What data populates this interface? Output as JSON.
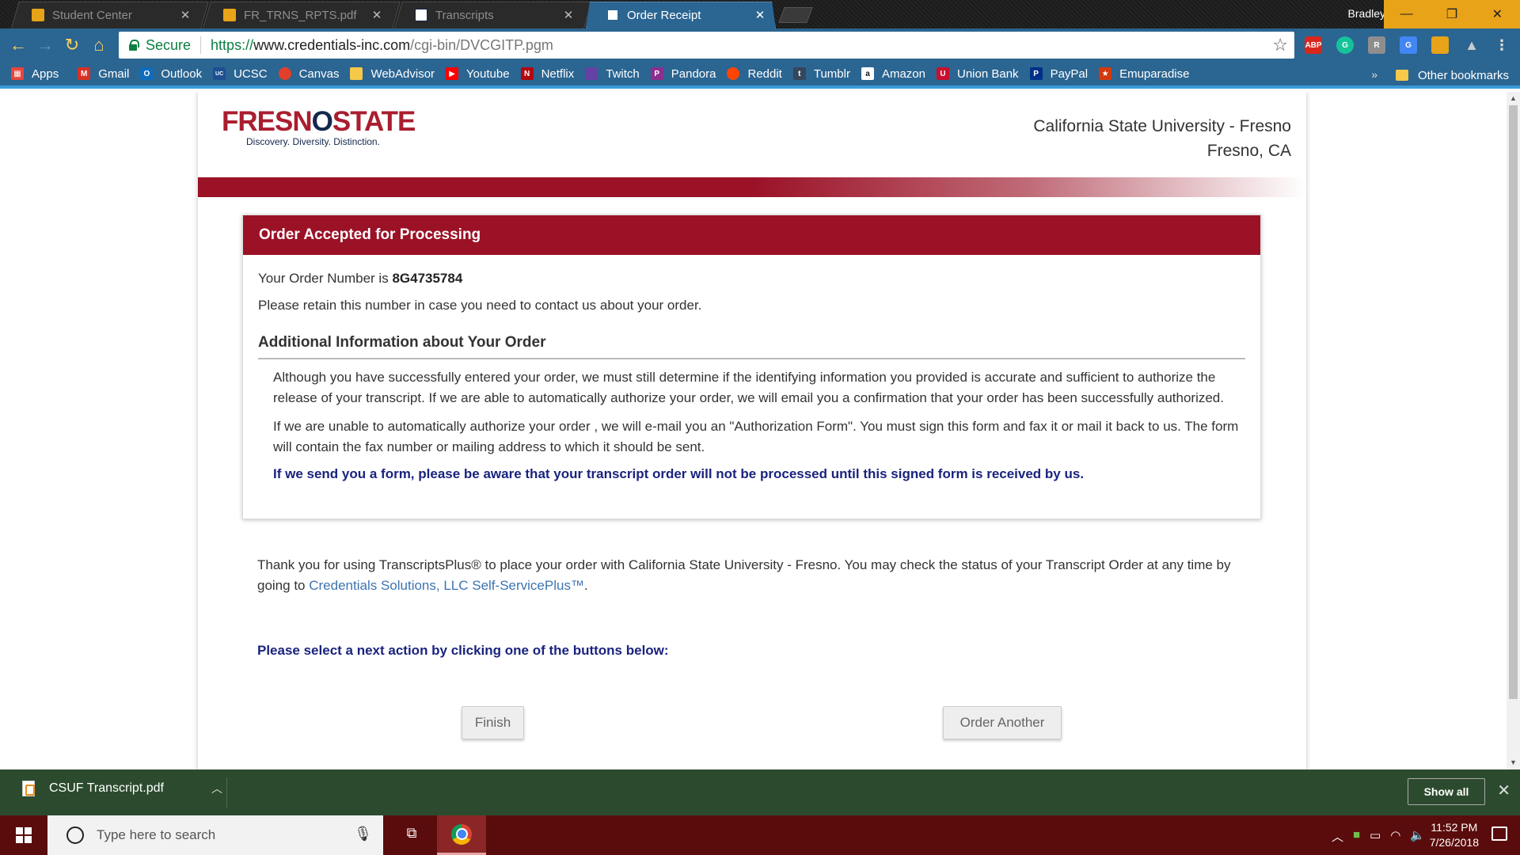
{
  "browser": {
    "tabs": [
      {
        "title": "Student Center",
        "active": false
      },
      {
        "title": "FR_TRNS_RPTS.pdf",
        "active": false
      },
      {
        "title": "Transcripts",
        "active": false
      },
      {
        "title": "Order Receipt",
        "active": true
      }
    ],
    "profile_name": "Bradley",
    "address": {
      "secure_label": "Secure",
      "url_proto": "https://",
      "url_host": "www.credentials-inc.com",
      "url_path": "/cgi-bin/DVCGITP.pgm"
    },
    "extensions": [
      {
        "icon": "adblock-plus-icon",
        "label": "ABP",
        "color": "#d9261c"
      },
      {
        "icon": "grammarly-icon",
        "label": "G",
        "color": "#15c39a"
      },
      {
        "icon": "extension-r-icon",
        "label": "R",
        "color": "#8e8e8e"
      },
      {
        "icon": "google-translate-icon",
        "label": "G",
        "color": "#4285f4"
      },
      {
        "icon": "color-picker-icon",
        "label": "",
        "color": "#e8a319"
      },
      {
        "icon": "google-drive-icon",
        "label": "",
        "color": "#888888"
      }
    ],
    "bookmarks": [
      {
        "label": "Apps",
        "icon": "apps-grid-icon",
        "color": "#e8453c"
      },
      {
        "label": "Gmail",
        "icon": "gmail-icon",
        "color": "#d93025"
      },
      {
        "label": "Outlook",
        "icon": "outlook-icon",
        "color": "#0f6cbd"
      },
      {
        "label": "UCSC",
        "icon": "ucsc-icon",
        "color": "#1d4f91"
      },
      {
        "label": "Canvas",
        "icon": "canvas-icon",
        "color": "#e13f2b"
      },
      {
        "label": "WebAdvisor",
        "icon": "page-icon",
        "color": "#f6c94a"
      },
      {
        "label": "Youtube",
        "icon": "youtube-icon",
        "color": "#ff0000"
      },
      {
        "label": "Netflix",
        "icon": "netflix-icon",
        "color": "#b20710"
      },
      {
        "label": "Twitch",
        "icon": "twitch-icon",
        "color": "#6441a5"
      },
      {
        "label": "Pandora",
        "icon": "pandora-icon",
        "color": "#8e2e8e"
      },
      {
        "label": "Reddit",
        "icon": "reddit-icon",
        "color": "#ff4500"
      },
      {
        "label": "Tumblr",
        "icon": "tumblr-icon",
        "color": "#35465c"
      },
      {
        "label": "Amazon",
        "icon": "amazon-icon",
        "color": "#111111"
      },
      {
        "label": "Union Bank",
        "icon": "union-bank-icon",
        "color": "#c8102e"
      },
      {
        "label": "PayPal",
        "icon": "paypal-icon",
        "color": "#003087"
      },
      {
        "label": "Emuparadise",
        "icon": "emuparadise-icon",
        "color": "#d4380d"
      }
    ],
    "bookmarks_more": "»",
    "other_bookmarks": "Other bookmarks"
  },
  "site": {
    "logo_main_a": "FRESN",
    "logo_main_b": "O",
    "logo_main_c": "STATE",
    "logo_tagline": "Discovery. Diversity. Distinction.",
    "institution": "California State University - Fresno",
    "location": "Fresno, CA"
  },
  "order": {
    "header": "Order Accepted for Processing",
    "number_prefix": "Your Order Number is ",
    "number": "8G4735784",
    "retain_note": "Please retain this number in case you need to contact us about your order.",
    "additional_heading": "Additional Information about Your Order",
    "para1": "Although you have successfully entered your order, we must still determine if the identifying information you provided is accurate and sufficient to authorize the release of your transcript. If we are able to automatically authorize your order, we will email you a confirmation that your order has been successfully authorized.",
    "para2": "If we are unable to automatically authorize your order , we will e-mail you an \"Authorization Form\". You must sign this form and fax it or mail it back to us. The form will contain the fax number or mailing address to which it should be sent.",
    "warning": "If we send you a form, please be aware that your transcript order will not be processed until this signed form is received by us."
  },
  "thanks": {
    "text": "Thank you for using TranscriptsPlus® to place your order with California State University - Fresno. You may check the status of your Transcript Order at any time by going to ",
    "link": "Credentials Solutions, LLC Self-ServicePlus™",
    "end": "."
  },
  "next_action": "Please select a next action by clicking one of the buttons below:",
  "buttons": {
    "finish": "Finish",
    "order_another": "Order Another"
  },
  "download": {
    "file": "CSUF Transcript.pdf",
    "show_all": "Show all"
  },
  "taskbar": {
    "search_placeholder": "Type here to search",
    "time": "11:52 PM",
    "date": "7/26/2018"
  },
  "colors": {
    "accent": "#9b1126",
    "chrome_frame": "#2b6591",
    "link": "#3d74b2",
    "warning": "#1a237e"
  }
}
